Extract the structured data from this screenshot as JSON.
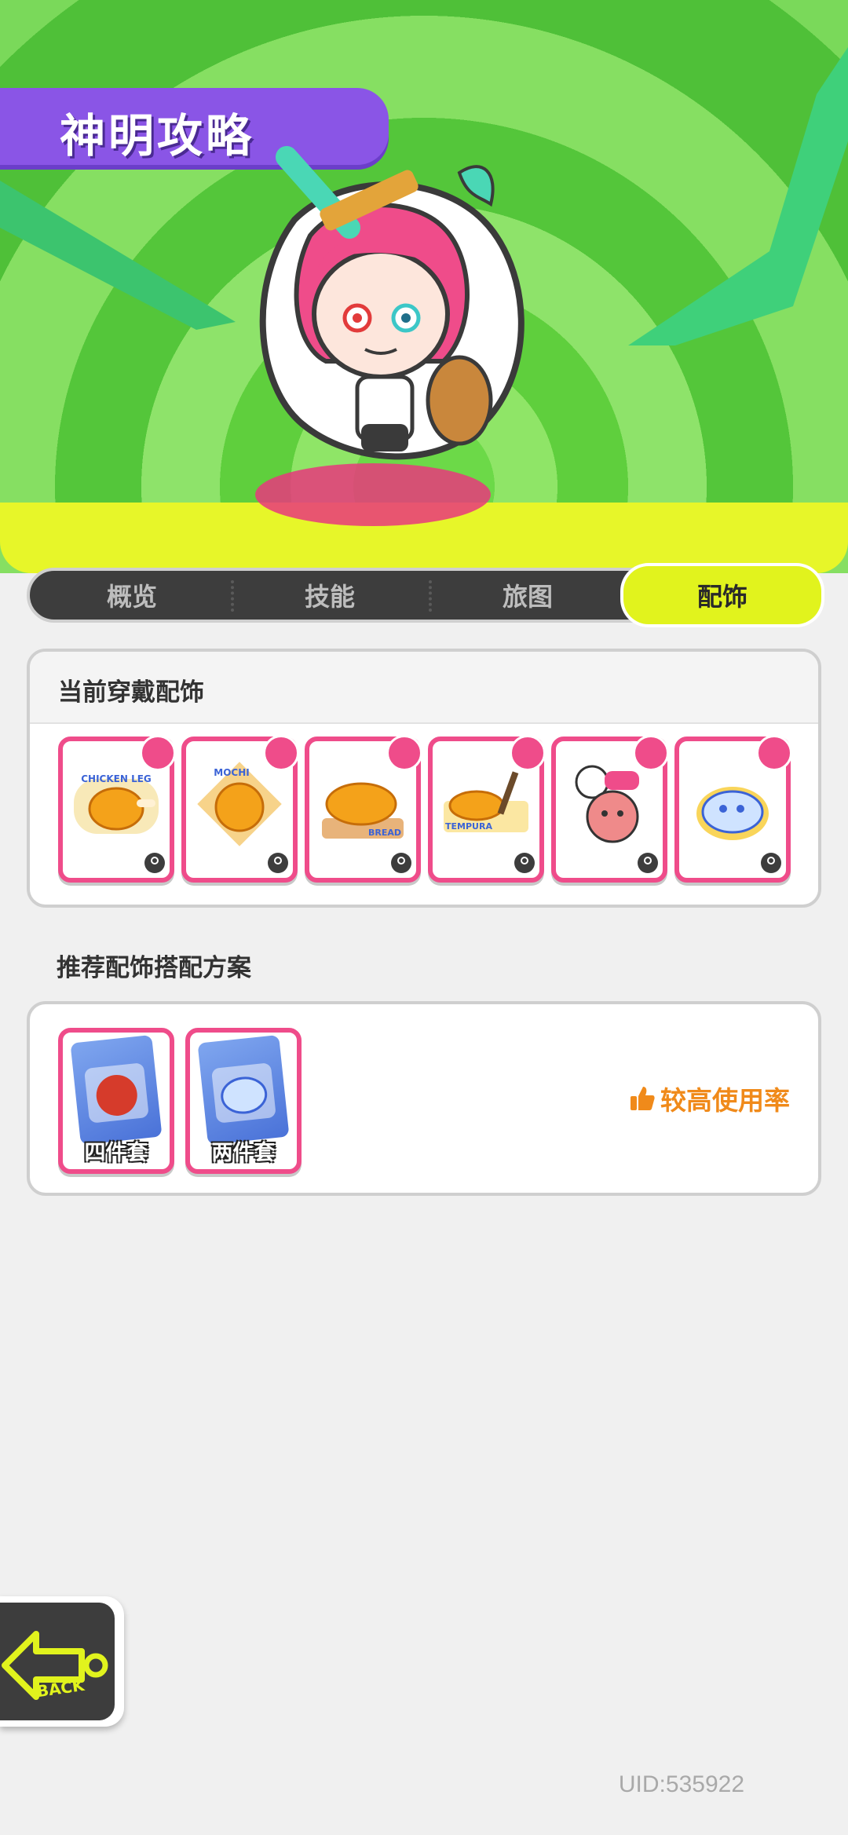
{
  "header": {
    "title": "神明攻略"
  },
  "tabs": [
    {
      "label": "概览",
      "active": false
    },
    {
      "label": "技能",
      "active": false
    },
    {
      "label": "旅图",
      "active": false
    },
    {
      "label": "配饰",
      "active": true
    }
  ],
  "current_section": {
    "title": "当前穿戴配饰",
    "items": [
      {
        "name": "CHICKEN LEG",
        "icon": "chicken-leg-icon"
      },
      {
        "name": "MOCHI",
        "icon": "mochi-icon"
      },
      {
        "name": "BREAD",
        "icon": "bread-icon"
      },
      {
        "name": "TEMPURA",
        "icon": "tempura-icon"
      },
      {
        "name": "",
        "icon": "cat-character-icon"
      },
      {
        "name": "",
        "icon": "blue-creature-icon"
      }
    ]
  },
  "recommend_section": {
    "title": "推荐配饰搭配方案",
    "sets": [
      {
        "label": "四件套",
        "icon": "four-piece-pack-icon"
      },
      {
        "label": "两件套",
        "icon": "two-piece-pack-icon"
      }
    ],
    "usage_label": "较高使用率"
  },
  "back_label": "BACK",
  "uid": "UID:535922",
  "colors": {
    "accent_pink": "#ef4c8a",
    "tab_active": "#e1f31d",
    "title_purple": "#8a55e6",
    "usage_orange": "#f08a1a"
  }
}
